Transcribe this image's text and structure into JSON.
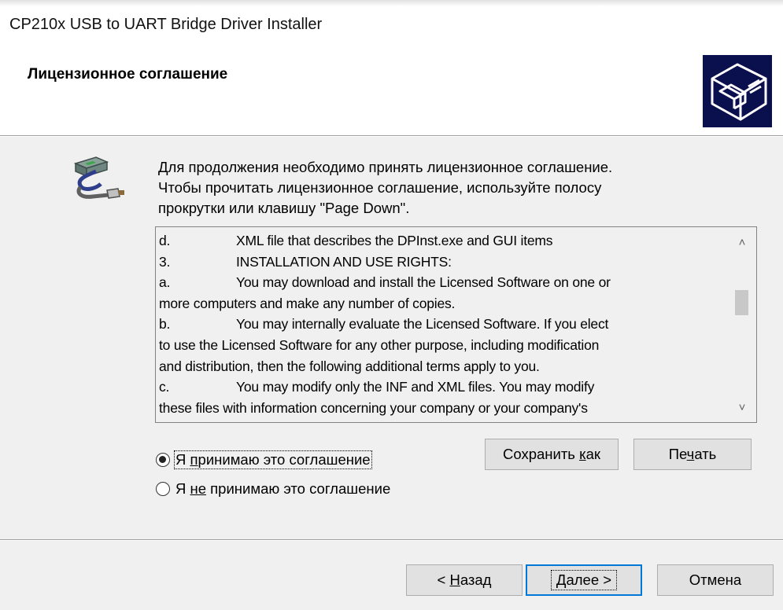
{
  "window": {
    "title": "CP210x USB to UART Bridge Driver Installer"
  },
  "header": {
    "title": "Лицензионное соглашение"
  },
  "instructions": {
    "lines": [
      "Для продолжения необходимо принять лицензионное соглашение.",
      "Чтобы прочитать лицензионное соглашение, используйте полосу",
      "прокрутки или клавишу \"Page Down\"."
    ]
  },
  "license": {
    "lines": [
      {
        "num": "d.",
        "text": "XML file that describes the DPInst.exe and GUI items"
      },
      {
        "num": "3.",
        "text": "INSTALLATION AND USE RIGHTS:"
      },
      {
        "num": "a.",
        "text": "You may download and install the Licensed Software on one or"
      },
      {
        "num": "",
        "text": "more computers and make any number of copies."
      },
      {
        "num": "b.",
        "text": "You may internally evaluate the Licensed Software.  If you elect"
      },
      {
        "num": "",
        "text": "to use the Licensed Software for any other purpose, including modification"
      },
      {
        "num": "",
        "text": "and distribution, then the following additional terms apply to you."
      },
      {
        "num": "c.",
        "text": "You may modify only the INF and XML files. You may modify"
      },
      {
        "num": "",
        "text": "these files with information concerning your company or your company's"
      }
    ],
    "scroll_position": 0.45
  },
  "options": {
    "accept": {
      "label_pre": "Я ",
      "label_ul": "п",
      "label_post": "ринимаю это соглашение",
      "checked": true
    },
    "decline": {
      "label_pre": "Я ",
      "label_ul": "не",
      "label_post": " принимаю это соглашение",
      "checked": false
    }
  },
  "buttons": {
    "save_as": {
      "pre": "Сохранить ",
      "ul": "к",
      "post": "ак"
    },
    "print": {
      "pre": "Пе",
      "ul": "ч",
      "post": "ать"
    },
    "back": {
      "pre": "< ",
      "ul": "Н",
      "post": "азад"
    },
    "next": {
      "pre": "",
      "ul": "Д",
      "post": "алее >"
    },
    "cancel": {
      "label": "Отмена"
    }
  },
  "colors": {
    "accent": "#0078d7",
    "banner_icon_bg": "#0a0f4d"
  },
  "icons": {
    "banner": "installer-box-icon",
    "main": "usb-cable-icon"
  }
}
